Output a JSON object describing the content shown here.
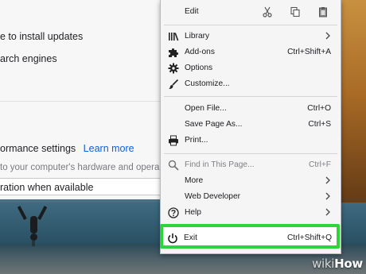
{
  "settings": {
    "line1": "e to install updates",
    "line2": "arch engines",
    "line3_text": "ormance settings",
    "line3_link": "Learn more",
    "line4": "to your computer's hardware and opera",
    "line5": "ration when available"
  },
  "menu": {
    "edit_label": "Edit",
    "items": [
      {
        "label": "Library",
        "icon": "library-icon",
        "submenu": true
      },
      {
        "label": "Add-ons",
        "icon": "puzzle-icon",
        "shortcut": "Ctrl+Shift+A"
      },
      {
        "label": "Options",
        "icon": "gear-icon"
      },
      {
        "label": "Customize...",
        "icon": "paintbrush-icon"
      },
      {
        "label": "Open File...",
        "shortcut": "Ctrl+O"
      },
      {
        "label": "Save Page As...",
        "shortcut": "Ctrl+S"
      },
      {
        "label": "Print...",
        "icon": "printer-icon"
      },
      {
        "label": "Find in This Page...",
        "icon": "search-icon",
        "shortcut": "Ctrl+F",
        "dim": true
      },
      {
        "label": "More",
        "submenu": true
      },
      {
        "label": "Web Developer",
        "submenu": true
      },
      {
        "label": "Help",
        "icon": "help-icon",
        "submenu": true
      }
    ],
    "exit": {
      "label": "Exit",
      "shortcut": "Ctrl+Shift+Q",
      "icon": "power-icon"
    }
  },
  "watermark": {
    "wiki": "wiki",
    "how": "How"
  },
  "colors": {
    "highlight": "#2dd53a",
    "link": "#0b60d6"
  }
}
